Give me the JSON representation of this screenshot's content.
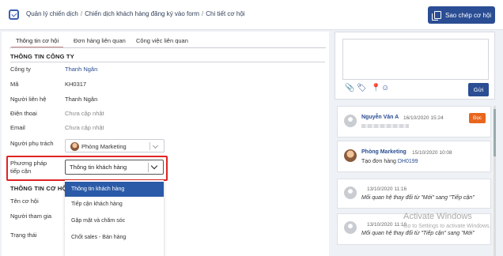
{
  "header": {
    "breadcrumb": [
      "Quản lý chiến dịch",
      "Chiến dịch khách hàng đăng ký vào form",
      "Chi tiết cơ hội"
    ],
    "copy_button": "Sao chép cơ hội"
  },
  "tabs": [
    "Thông tin cơ hội",
    "Đơn hàng liên quan",
    "Công việc liên quan"
  ],
  "company": {
    "title": "THÔNG TIN CÔNG TY",
    "fields": [
      {
        "label": "Công ty",
        "value": "Thanh Ngân"
      },
      {
        "label": "Mã",
        "value": "KH0317"
      },
      {
        "label": "Người liên hệ",
        "value": "Thanh Ngân"
      },
      {
        "label": "Điện thoại",
        "value": "Chưa cập nhật"
      },
      {
        "label": "Email",
        "value": "Chưa cập nhật"
      }
    ],
    "owner_label": "Người phụ trách",
    "owner_value": "Phòng Marketing",
    "method_label_1": "Phương pháp",
    "method_label_2": "tiếp cận",
    "method_value": "Thông tin khách hàng"
  },
  "opportunity": {
    "title": "THÔNG TIN CƠ HỘI",
    "labels": [
      "Tên cơ hội",
      "Người tham gia",
      "Trạng thái"
    ]
  },
  "dropdown": {
    "options": [
      "Thông tin khách hàng",
      "Tiếp cận khách hàng",
      "Gặp mặt và chăm sóc",
      "Chốt sales - Bán hàng"
    ]
  },
  "composer": {
    "send_label": "Gửi"
  },
  "feed": [
    {
      "name": "Nguyễn Văn A",
      "time": "16/10/2020 15:24",
      "button": "Đọc"
    },
    {
      "name": "Phòng Marketing",
      "time": "15/10/2020 10:08",
      "body_prefix": "Tạo đơn hàng ",
      "body_link": "DH0199"
    },
    {
      "time": "13/10/2020 11:16",
      "body": "Mối quan hệ thay đổi từ \"Mới\" sang \"Tiếp cận\""
    },
    {
      "time": "13/10/2020 11:16",
      "body": "Mối quan hệ thay đổi từ \"Tiếp cận\" sang \"Mới\""
    }
  ],
  "watermark": {
    "line1": "Activate Windows",
    "line2": "Go to Settings to activate Windows."
  },
  "colors": {
    "primary": "#2a4d93",
    "selected": "#2a5aa8",
    "read": "#e8661d",
    "highlight": "#e02424"
  }
}
